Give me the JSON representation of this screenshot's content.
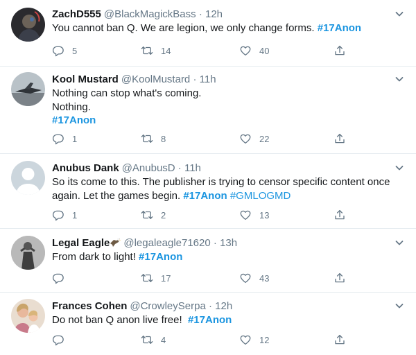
{
  "tweets": [
    {
      "name": "ZachD555",
      "handle": "@BlackMagickBass",
      "time": "12h",
      "lines": [
        {
          "text": "You cannot ban Q. We are legion, we only change forms. ",
          "tag": "#17Anon"
        }
      ],
      "replies": "5",
      "retweets": "14",
      "likes": "40"
    },
    {
      "name": "Kool Mustard",
      "handle": "@KoolMustard",
      "time": "11h",
      "lines": [
        {
          "text": "Nothing can stop what's coming."
        },
        {
          "text": "Nothing."
        },
        {
          "text": "",
          "tag": "#17Anon"
        }
      ],
      "replies": "1",
      "retweets": "8",
      "likes": "22"
    },
    {
      "name": "Anubus Dank",
      "handle": "@AnubusD",
      "time": "11h",
      "lines": [
        {
          "text": "So its come to this. The publisher is trying to censor specific content once"
        },
        {
          "text": "again. Let the games begin. ",
          "tag": "#17Anon",
          "tag2": "#GMLOGMD"
        }
      ],
      "replies": "1",
      "retweets": "2",
      "likes": "13"
    },
    {
      "name": "Legal Eagle",
      "handle": "@legaleagle71620",
      "time": "13h",
      "lines": [
        {
          "text": "From dark to light! ",
          "tag": "#17Anon"
        }
      ],
      "replies": "",
      "retweets": "17",
      "likes": "43"
    },
    {
      "name": "Frances Cohen",
      "handle": "@CrowleySerpa",
      "time": "12h",
      "lines": [
        {
          "text": "Do not ban Q anon live free!  ",
          "tag": "#17Anon"
        }
      ],
      "replies": "",
      "retweets": "4",
      "likes": "12"
    }
  ],
  "separator": "·",
  "icons": {
    "reply": "reply-icon",
    "retweet": "retweet-icon",
    "like": "heart-icon",
    "share": "share-icon",
    "more": "chevron-down-icon",
    "eagle_emoji": "eagle-emoji-icon"
  },
  "colors": {
    "link": "#1b95e0",
    "secondary": "#657786",
    "border": "#e6ecf0"
  }
}
